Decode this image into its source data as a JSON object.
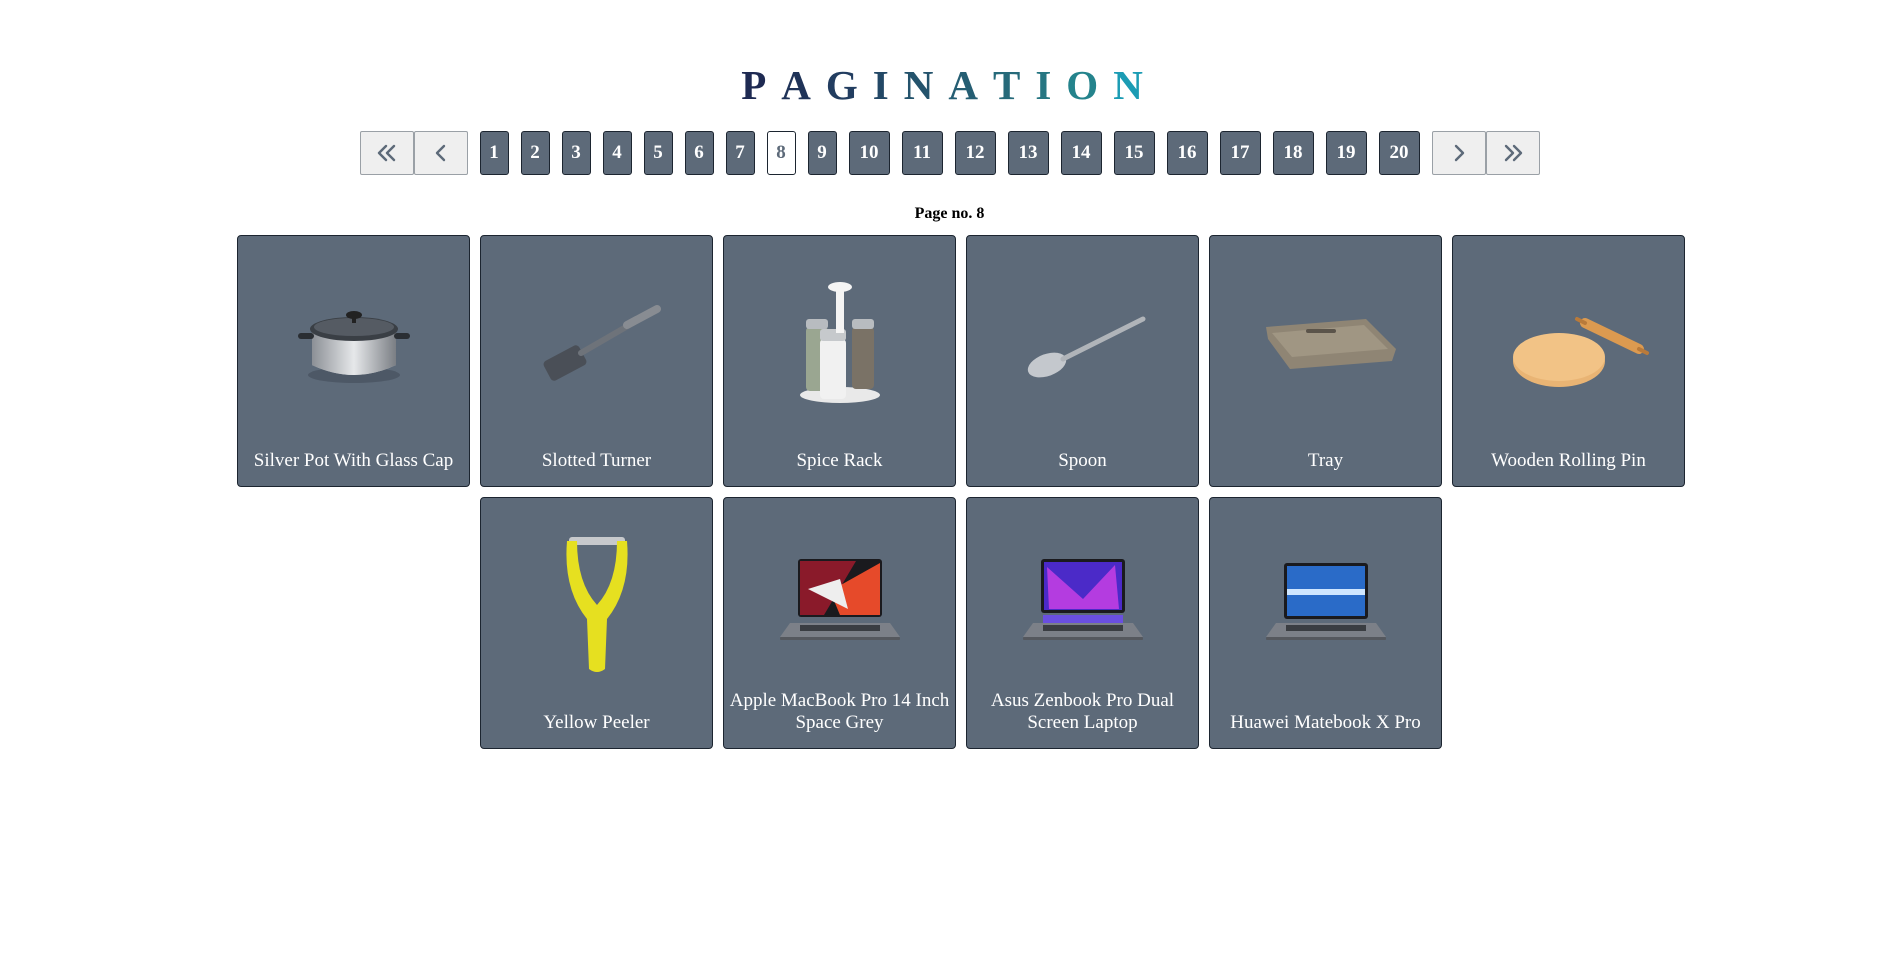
{
  "title": "PAGINATION",
  "title_colors": [
    "#1e2a52",
    "#1f3358",
    "#223d60",
    "#234866",
    "#24536c",
    "#255e73",
    "#266a7a",
    "#267682",
    "#24838c",
    "#1c9cb4"
  ],
  "pagination": {
    "pages": [
      "1",
      "2",
      "3",
      "4",
      "5",
      "6",
      "7",
      "8",
      "9",
      "10",
      "11",
      "12",
      "13",
      "14",
      "15",
      "16",
      "17",
      "18",
      "19",
      "20"
    ],
    "current": "8",
    "first_icon": "double-chevron-left-icon",
    "prev_icon": "chevron-left-icon",
    "next_icon": "chevron-right-icon",
    "last_icon": "double-chevron-right-icon"
  },
  "page_label": "Page no. 8",
  "products": [
    {
      "name": "Silver Pot With Glass Cap",
      "icon": "pot-icon"
    },
    {
      "name": "Slotted Turner",
      "icon": "spatula-icon"
    },
    {
      "name": "Spice Rack",
      "icon": "spice-rack-icon"
    },
    {
      "name": "Spoon",
      "icon": "spoon-icon"
    },
    {
      "name": "Tray",
      "icon": "tray-icon"
    },
    {
      "name": "Wooden Rolling Pin",
      "icon": "rolling-pin-icon"
    },
    {
      "name": "Yellow Peeler",
      "icon": "peeler-icon"
    },
    {
      "name": "Apple MacBook Pro 14 Inch Space Grey",
      "icon": "laptop-icon"
    },
    {
      "name": "Asus Zenbook Pro Dual Screen Laptop",
      "icon": "laptop-icon"
    },
    {
      "name": "Huawei Matebook X Pro",
      "icon": "laptop-icon"
    }
  ],
  "colors": {
    "card_bg": "#5d6a79",
    "card_border": "#1c2530",
    "active_page_bg": "#ffffff",
    "nav_bg": "#efefef"
  }
}
